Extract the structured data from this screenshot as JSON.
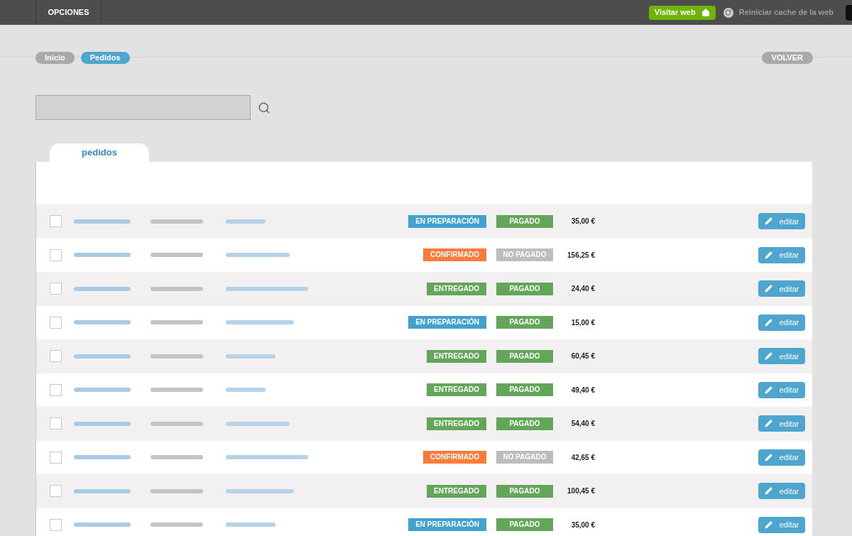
{
  "top_bar": {
    "menu": "OPCIONES",
    "visit_button": "Visitar web",
    "cache_link": "Reiniciar cache de la web"
  },
  "breadcrumbs": [
    {
      "label": "Inicio",
      "selected": false
    },
    {
      "label": "Pedidos",
      "selected": true
    }
  ],
  "back_button": "VOLVER",
  "tab": "pedidos",
  "rows": [
    {
      "checked": false,
      "status": {
        "text": "EN PREPARACIÓN",
        "color": "#3fa2cf"
      },
      "payment": {
        "text": "PAGADO",
        "color": "#63a659"
      },
      "total": "35,00 €",
      "edit": "editar"
    },
    {
      "checked": false,
      "status": {
        "text": "CONFIRMADO",
        "color": "#fa7b3a"
      },
      "payment": {
        "text": "NO PAGADO",
        "color": "#bdbdbd"
      },
      "total": "156,25 €",
      "edit": "editar"
    },
    {
      "checked": false,
      "status": {
        "text": "ENTREGADO",
        "color": "#63a659"
      },
      "payment": {
        "text": "PAGADO",
        "color": "#63a659"
      },
      "total": "24,40 €",
      "edit": "editar"
    },
    {
      "checked": false,
      "status": {
        "text": "EN PREPARACIÓN",
        "color": "#3fa2cf"
      },
      "payment": {
        "text": "PAGADO",
        "color": "#63a659"
      },
      "total": "15,00 €",
      "edit": "editar"
    },
    {
      "checked": false,
      "status": {
        "text": "ENTREGADO",
        "color": "#63a659"
      },
      "payment": {
        "text": "PAGADO",
        "color": "#63a659"
      },
      "total": "60,45 €",
      "edit": "editar"
    },
    {
      "checked": false,
      "status": {
        "text": "ENTREGADO",
        "color": "#63a659"
      },
      "payment": {
        "text": "PAGADO",
        "color": "#63a659"
      },
      "total": "49,40 €",
      "edit": "editar"
    },
    {
      "checked": false,
      "status": {
        "text": "ENTREGADO",
        "color": "#63a659"
      },
      "payment": {
        "text": "PAGADO",
        "color": "#63a659"
      },
      "total": "54,40 €",
      "edit": "editar"
    },
    {
      "checked": false,
      "status": {
        "text": "CONFIRMADO",
        "color": "#fa7b3a"
      },
      "payment": {
        "text": "NO PAGADO",
        "color": "#bdbdbd"
      },
      "total": "42,65 €",
      "edit": "editar"
    },
    {
      "checked": false,
      "status": {
        "text": "ENTREGADO",
        "color": "#63a659"
      },
      "payment": {
        "text": "PAGADO",
        "color": "#63a659"
      },
      "total": "100,45 €",
      "edit": "editar"
    },
    {
      "checked": false,
      "status": {
        "text": "EN PREPARACIÓN",
        "color": "#3fa2cf"
      },
      "payment": {
        "text": "PAGADO",
        "color": "#63a659"
      },
      "total": "35,00 €",
      "edit": "editar"
    }
  ]
}
